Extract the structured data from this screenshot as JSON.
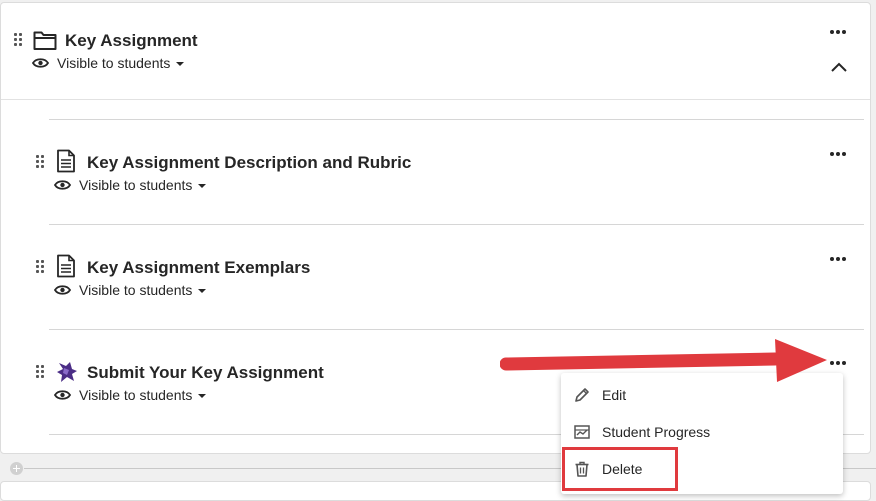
{
  "folder": {
    "title": "Key Assignment",
    "visibility": "Visible to students"
  },
  "items": [
    {
      "title": "Key Assignment Description and Rubric",
      "visibility": "Visible to students",
      "icon": "document-icon"
    },
    {
      "title": "Key Assignment Exemplars",
      "visibility": "Visible to students",
      "icon": "document-icon"
    },
    {
      "title": "Submit Your Key Assignment",
      "visibility": "Visible to students",
      "icon": "assignment-puzzle-icon"
    }
  ],
  "context_menu": {
    "items": [
      {
        "label": "Edit",
        "icon": "pencil-icon"
      },
      {
        "label": "Student Progress",
        "icon": "progress-chart-icon"
      },
      {
        "label": "Delete",
        "icon": "trash-icon"
      }
    ]
  },
  "annotation": {
    "arrow_color": "#e03a3e",
    "highlight_color": "#e03a3e"
  }
}
